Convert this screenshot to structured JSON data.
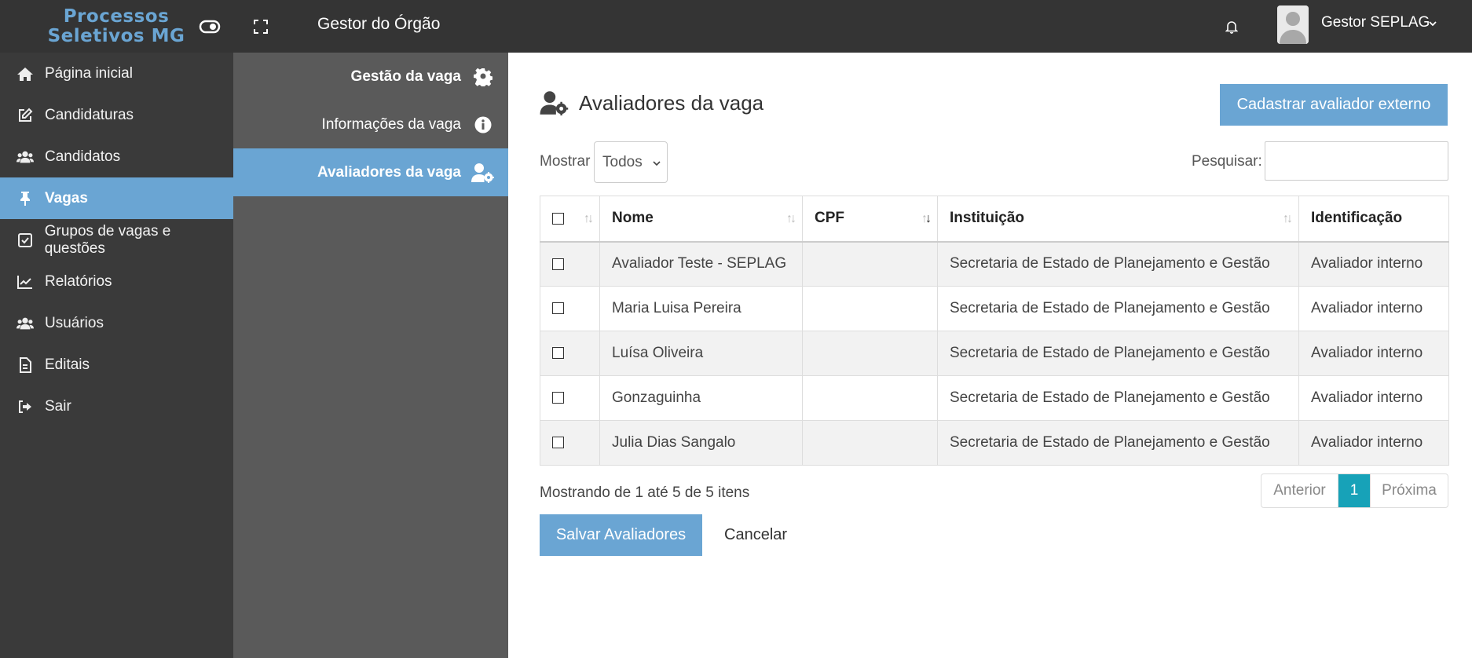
{
  "app": {
    "logo_line1": "Processos",
    "logo_line2": "Seletivos MG",
    "role_title": "Gestor do Órgão"
  },
  "user": {
    "name": "Gestor SEPLAG"
  },
  "sidebar": {
    "items": [
      {
        "label": "Página inicial",
        "icon": "home-icon"
      },
      {
        "label": "Candidaturas",
        "icon": "edit-icon"
      },
      {
        "label": "Candidatos",
        "icon": "users-icon"
      },
      {
        "label": "Vagas",
        "icon": "pin-icon",
        "active": true
      },
      {
        "label": "Grupos de vagas e questões",
        "icon": "check-square-icon"
      },
      {
        "label": "Relatórios",
        "icon": "chart-line-icon"
      },
      {
        "label": "Usuários",
        "icon": "users-icon"
      },
      {
        "label": "Editais",
        "icon": "file-icon"
      },
      {
        "label": "Sair",
        "icon": "sign-out-icon"
      }
    ]
  },
  "subpanel": {
    "items": [
      {
        "label": "Gestão da vaga",
        "icon": "gear-icon"
      },
      {
        "label": "Informações da vaga",
        "icon": "info-icon"
      },
      {
        "label": "Avaliadores da vaga",
        "icon": "user-gear-icon",
        "active": true
      }
    ]
  },
  "main": {
    "title": "Avaliadores da vaga",
    "add_external_button": "Cadastrar avaliador externo",
    "show_label": "Mostrar",
    "show_value": "Todos",
    "search_label": "Pesquisar:",
    "search_value": "",
    "table": {
      "headers": [
        "Nome",
        "CPF",
        "Instituição",
        "Identificação"
      ],
      "rows": [
        {
          "nome": "Avaliador Teste - SEPLAG",
          "cpf": "",
          "instituicao": "Secretaria de Estado de Planejamento e Gestão",
          "identificacao": "Avaliador interno"
        },
        {
          "nome": "Maria Luisa Pereira",
          "cpf": "",
          "instituicao": "Secretaria de Estado de Planejamento e Gestão",
          "identificacao": "Avaliador interno"
        },
        {
          "nome": "Luísa Oliveira",
          "cpf": "",
          "instituicao": "Secretaria de Estado de Planejamento e Gestão",
          "identificacao": "Avaliador interno"
        },
        {
          "nome": "Gonzaguinha",
          "cpf": "",
          "instituicao": "Secretaria de Estado de Planejamento e Gestão",
          "identificacao": "Avaliador interno"
        },
        {
          "nome": "Julia Dias Sangalo",
          "cpf": "",
          "instituicao": "Secretaria de Estado de Planejamento e Gestão",
          "identificacao": "Avaliador interno"
        }
      ]
    },
    "info_text": "Mostrando de 1 até 5 de 5 itens",
    "pager": {
      "prev": "Anterior",
      "current": "1",
      "next": "Próxima"
    },
    "save_button": "Salvar Avaliadores",
    "cancel_button": "Cancelar"
  },
  "colors": {
    "accent": "#6aa5d3",
    "topbar": "#343434",
    "sidebar": "#3a3a3a",
    "subpanel": "#5a5a5a",
    "pager_active": "#17a2b8"
  }
}
